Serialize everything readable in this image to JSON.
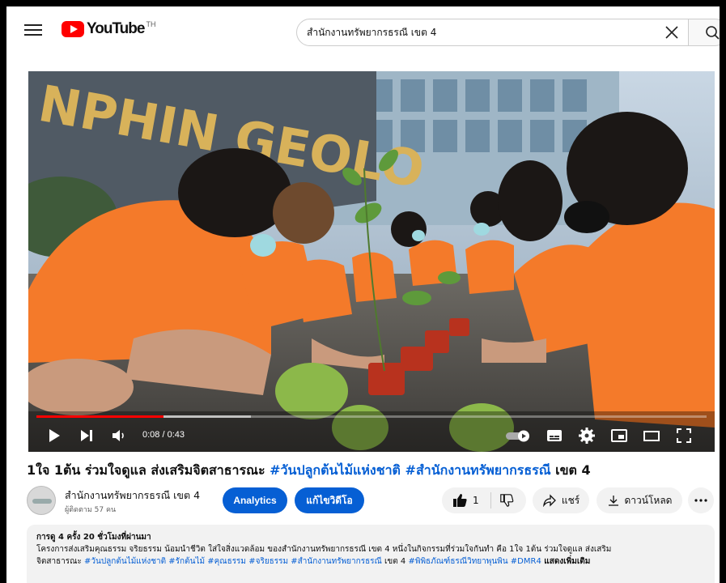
{
  "header": {
    "logo_text": "YouTube",
    "country_code": "TH",
    "search_value": "สำนักงานทรัพยากรธรณี เขต 4"
  },
  "player": {
    "time": "0:08 / 0:43",
    "progress_fraction": 0.19,
    "buffer_fraction": 0.32
  },
  "video": {
    "title_plain": "1ใจ 1ต้น ร่วมใจดูแล ส่งเสริมจิตสาธารณะ ",
    "title_tag1": "#วันปลูกต้นไม้แห่งชาติ",
    "title_tag2": "#สำนักงานทรัพยากรธรณี",
    "title_end": " เขต 4"
  },
  "channel": {
    "name": "สำนักงานทรัพยากรธรณี เขต 4",
    "subscribers": "ผู้ติดตาม 57 คน",
    "analytics_label": "Analytics",
    "edit_label": "แก้ไขวิดีโอ"
  },
  "actions": {
    "like_count": "1",
    "share_label": "แชร์",
    "download_label": "ดาวน์โหลด"
  },
  "description": {
    "meta": "การดู 4 ครั้ง  20 ชั่วโมงที่ผ่านมา",
    "line1": "โครงการส่งเสริมคุณธรรม จริยธรรม น้อมนำชีวิต ใส่ใจสิ่งแวดล้อม ของสำนักงานทรัพยากรธรณี เขต 4 หนึ่งในกิจกรรมที่ร่วมใจกันทำ คือ 1ใจ 1ต้น ร่วมใจดูแล ส่งเสริม",
    "line2_start": "จิตสาธารณะ  ",
    "line2_tags": "#วันปลูกต้นไม้แห่งชาติ #รักต้นไม้ #คุณธรรม #จริยธรรม #สำนักงานทรัพยากรธรณี",
    "line2_mid": " เขต 4 ",
    "line2_tags2": "#พิพิธภัณฑ์ธรณีวิทยาพุนพิน #DMR4",
    "more_label": " แสดงเพิ่มเติม"
  },
  "colors": {
    "brand": "#ff0000",
    "link": "#065fd4",
    "shirt": "#f47a2a"
  }
}
